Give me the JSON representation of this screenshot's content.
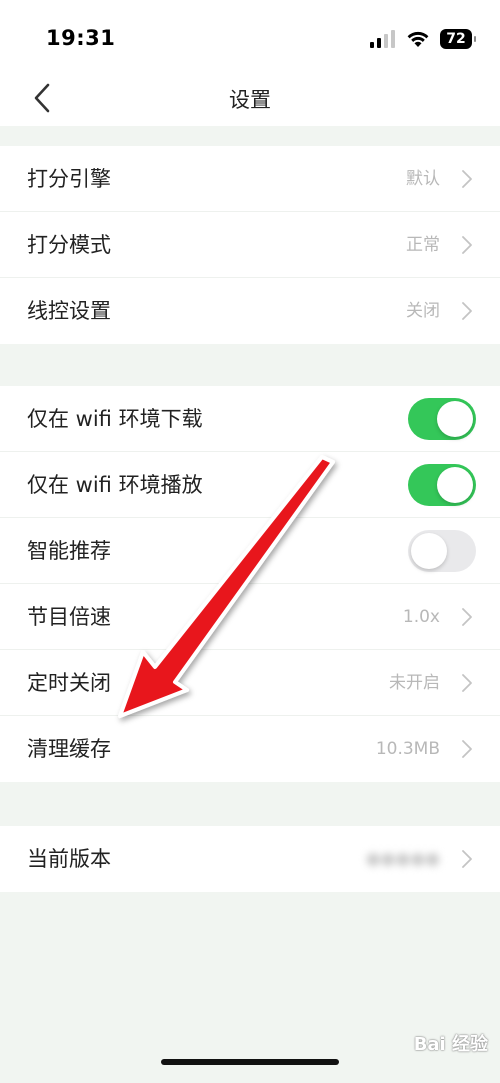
{
  "status": {
    "time": "19:31",
    "battery": "72"
  },
  "nav": {
    "title": "设置"
  },
  "group1": [
    {
      "label": "打分引擎",
      "value": "默认"
    },
    {
      "label": "打分模式",
      "value": "正常"
    },
    {
      "label": "线控设置",
      "value": "关闭"
    }
  ],
  "group2": [
    {
      "label": "仅在 wifi 环境下载",
      "toggle": true
    },
    {
      "label": "仅在 wifi 环境播放",
      "toggle": true
    },
    {
      "label": "智能推荐",
      "toggle": false
    },
    {
      "label": "节目倍速",
      "value": "1.0x"
    },
    {
      "label": "定时关闭",
      "value": "未开启"
    },
    {
      "label": "清理缓存",
      "value": "10.3MB"
    }
  ],
  "group3": [
    {
      "label": "当前版本"
    }
  ],
  "colors": {
    "toggle_on": "#34c759",
    "toggle_off": "#e9e9eb",
    "arrow": "#e8141c",
    "background": "#f1f5f1"
  },
  "watermark": "Bai 经验"
}
